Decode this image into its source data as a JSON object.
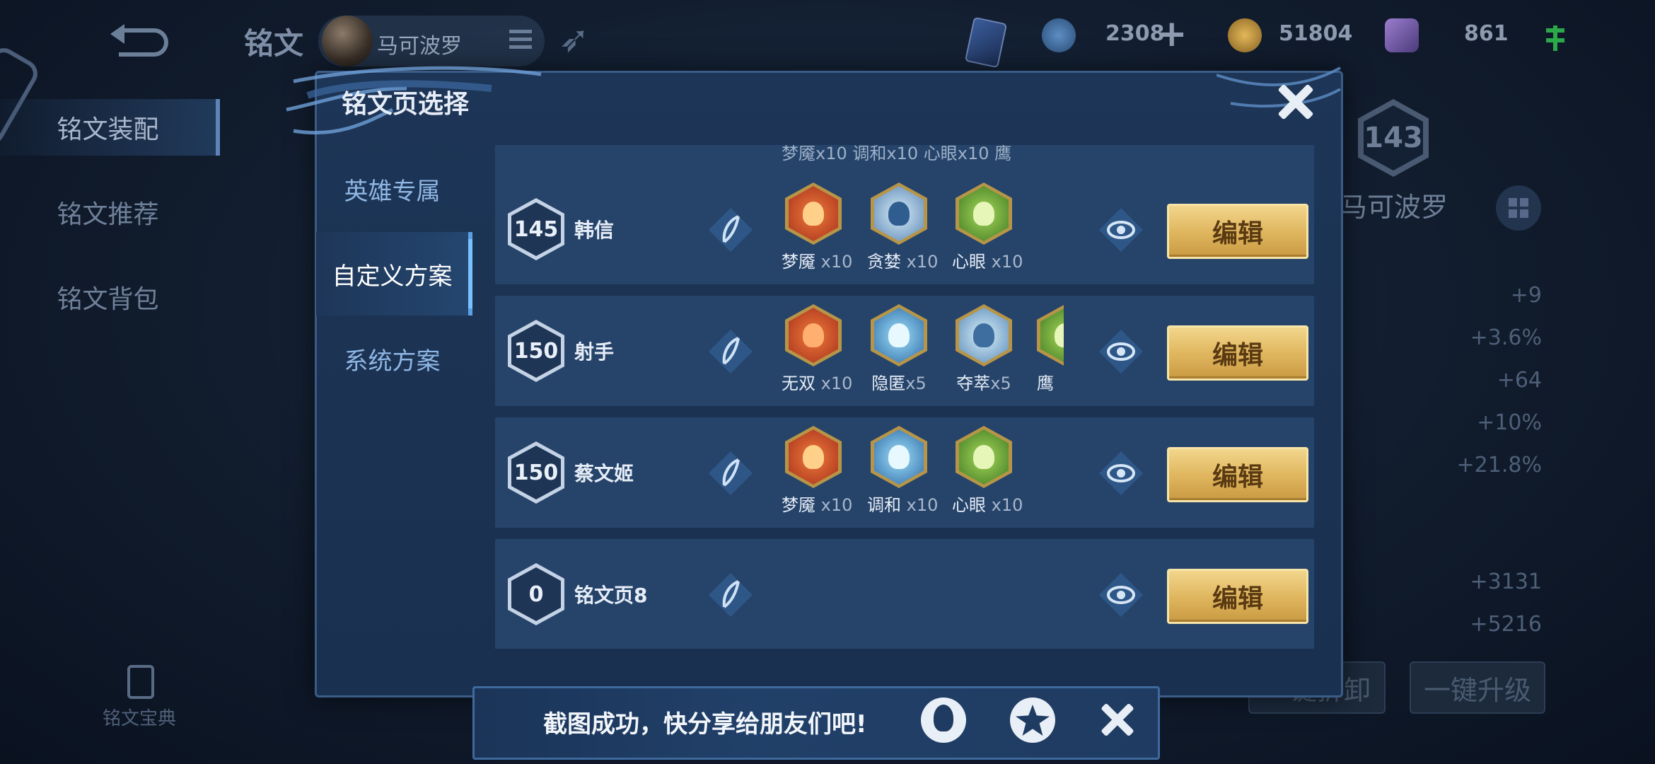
{
  "background": {
    "page_title": "铭文",
    "hero_name": "马可波罗",
    "currencies": [
      {
        "icon": "coupon-icon",
        "value": "2308"
      },
      {
        "icon": "gold-coin-icon",
        "value": "51804"
      },
      {
        "icon": "gem-icon",
        "value": "861"
      }
    ],
    "sidenav": [
      "铭文装配",
      "铭文推荐",
      "铭文背包"
    ],
    "codex_label": "铭文宝典",
    "hero_level": "143",
    "hero_label": "马可波罗",
    "stats": [
      "+9",
      "+3.6%",
      "+64",
      "+10%",
      "+21.8%",
      "+3131",
      "+5216"
    ],
    "buttons": [
      "一键拆卸",
      "一键升级"
    ]
  },
  "dialog": {
    "title": "铭文页选择",
    "tabs": [
      "英雄专属",
      "自定义方案",
      "系统方案"
    ],
    "active_tab": 1,
    "edit_label": "编辑",
    "partial_row": {
      "runes_text": "梦魇x10  调和x10  心眼x10  鹰"
    },
    "rows": [
      {
        "level": "145",
        "name": "韩信",
        "runes": [
          {
            "name": "梦魇",
            "count": "x10",
            "color": "red"
          },
          {
            "name": "贪婪",
            "count": "x10",
            "color": "blue"
          },
          {
            "name": "心眼",
            "count": "x10",
            "color": "green"
          }
        ]
      },
      {
        "level": "150",
        "name": "射手",
        "runes": [
          {
            "name": "无双",
            "count": "x10",
            "color": "red"
          },
          {
            "name": "隐匿",
            "count": "x5",
            "color": "blue"
          },
          {
            "name": "夺萃",
            "count": "x5",
            "color": "blue"
          },
          {
            "name": "鹰",
            "count": "",
            "color": "green"
          }
        ]
      },
      {
        "level": "150",
        "name": "蔡文姬",
        "runes": [
          {
            "name": "梦魇",
            "count": "x10",
            "color": "red"
          },
          {
            "name": "调和",
            "count": "x10",
            "color": "blue"
          },
          {
            "name": "心眼",
            "count": "x10",
            "color": "green"
          }
        ]
      },
      {
        "level": "0",
        "name": "铭文页8",
        "runes": []
      }
    ]
  },
  "toast": {
    "message": "截图成功，快分享给朋友们吧!"
  },
  "colors": {
    "red": "#d2562a",
    "blue": "#5e9fd8",
    "green": "#6aa83a",
    "gold": "#e0b760"
  }
}
